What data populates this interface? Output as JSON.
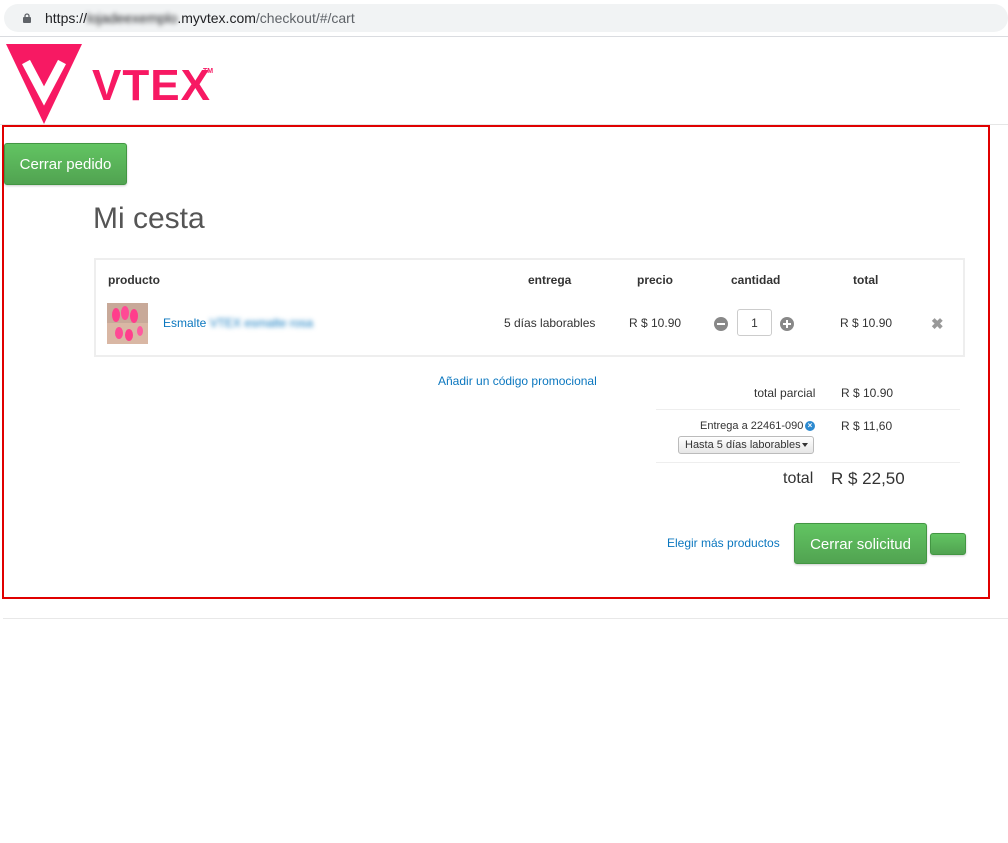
{
  "browser": {
    "url_prefix": "https://",
    "url_blurred": "lojadeexemplo",
    "url_domain": ".myvtex.com",
    "url_path": "/checkout/#/cart"
  },
  "logo": {
    "text": "VTEX",
    "tm": "TM",
    "color": "#f71963"
  },
  "header": {
    "close_order_label": "Cerrar pedido"
  },
  "cart": {
    "title": "Mi cesta",
    "columns": {
      "product": "producto",
      "delivery": "entrega",
      "price": "precio",
      "quantity": "cantidad",
      "total": "total"
    },
    "items": [
      {
        "name_visible": "Esmalte",
        "name_blurred": "VTEX esmalte rosa",
        "delivery": "5 días laborables",
        "price": "R $ 10.90",
        "quantity": "1",
        "total": "R $ 10.90"
      }
    ]
  },
  "summary": {
    "promo_link": "Añadir un código promocional",
    "subtotal_label": "total parcial",
    "subtotal_value": "R $ 10.90",
    "shipping_label": "Entrega a 22461-090",
    "shipping_value": "R $ 11,60",
    "shipping_option": "Hasta 5 días laborables",
    "total_label": "total",
    "total_value": "R $ 22,50"
  },
  "actions": {
    "continue_shopping": "Elegir más productos",
    "submit": "Cerrar solicitud"
  },
  "colors": {
    "accent_green": "#5cb85c",
    "link_blue": "#0b77bf",
    "highlight_red": "#e00000"
  }
}
